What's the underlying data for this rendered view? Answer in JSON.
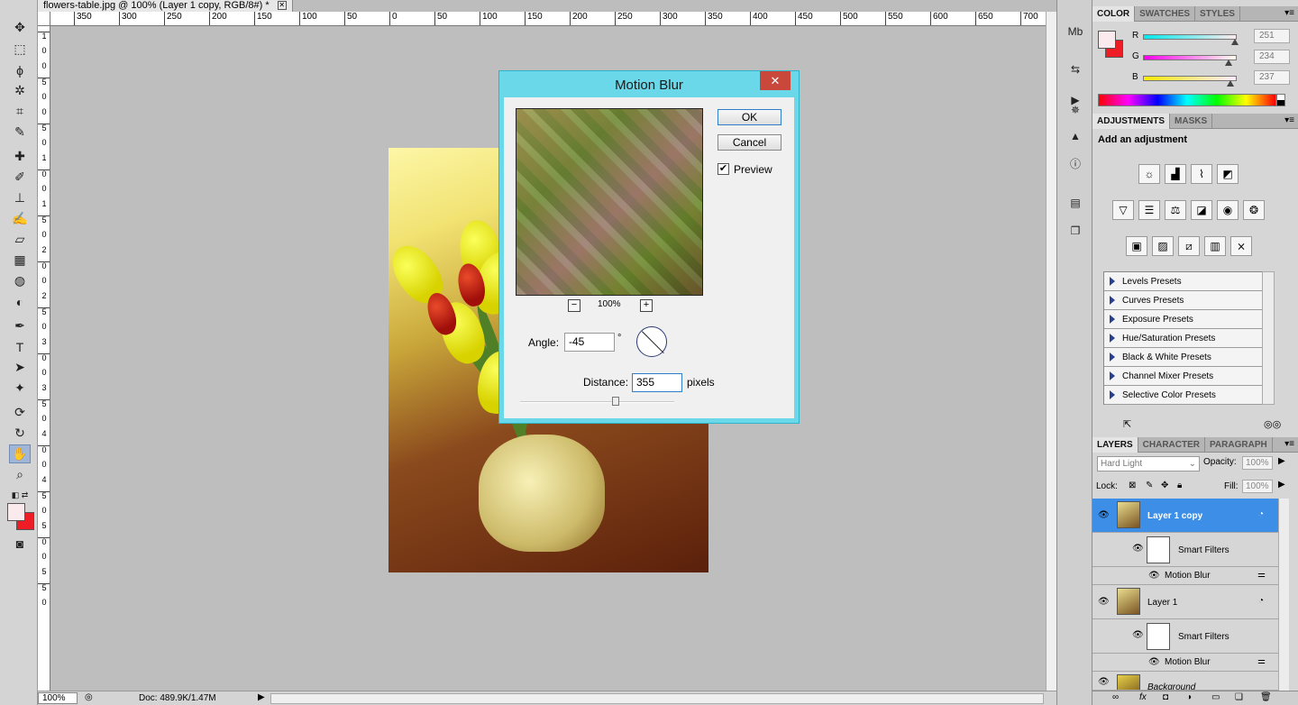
{
  "document": {
    "tab_title": "flowers-table.jpg @ 100% (Layer 1 copy, RGB/8#) *",
    "close_glyph": "✕"
  },
  "rulers": {
    "top_labels": [
      "350",
      "300",
      "250",
      "200",
      "150",
      "100",
      "50",
      "0",
      "50",
      "100",
      "150",
      "200",
      "250",
      "300",
      "350",
      "400",
      "450",
      "500",
      "550",
      "600",
      "650",
      "700"
    ],
    "left_labels": [
      "1",
      "0",
      "0",
      "5",
      "0",
      "0",
      "5",
      "0",
      "1",
      "0",
      "0",
      "1",
      "5",
      "0",
      "2",
      "0",
      "0",
      "2",
      "5",
      "0",
      "3",
      "0",
      "0",
      "3",
      "5",
      "0",
      "4",
      "0",
      "0",
      "4",
      "5",
      "0",
      "5",
      "0",
      "0",
      "5",
      "5",
      "0"
    ]
  },
  "statusbar": {
    "zoom": "100%",
    "doc_info": "Doc: 489.9K/1.47M"
  },
  "color_panel": {
    "tabs": [
      "COLOR",
      "SWATCHES",
      "STYLES"
    ],
    "channels": [
      {
        "label": "R",
        "value": "251",
        "fraction": 0.984
      },
      {
        "label": "G",
        "value": "234",
        "fraction": 0.918
      },
      {
        "label": "B",
        "value": "237",
        "fraction": 0.929
      }
    ],
    "foreground": "#fbeaed",
    "background": "#ee1c24"
  },
  "adjustments_panel": {
    "tabs": [
      "ADJUSTMENTS",
      "MASKS"
    ],
    "title": "Add an adjustment",
    "presets": [
      "Levels Presets",
      "Curves Presets",
      "Exposure Presets",
      "Hue/Saturation Presets",
      "Black & White Presets",
      "Channel Mixer Presets",
      "Selective Color Presets"
    ]
  },
  "layers_panel": {
    "tabs": [
      "LAYERS",
      "CHARACTER",
      "PARAGRAPH"
    ],
    "blend_mode": "Hard Light",
    "opacity_label": "Opacity:",
    "opacity": "100%",
    "lock_label": "Lock:",
    "fill_label": "Fill:",
    "fill": "100%",
    "layers": [
      {
        "name": "Layer 1 copy",
        "selected": true,
        "smart_filters": "Smart Filters",
        "filter": "Motion Blur"
      },
      {
        "name": "Layer 1",
        "selected": false,
        "smart_filters": "Smart Filters",
        "filter": "Motion Blur"
      },
      {
        "name": "Background",
        "selected": false
      }
    ]
  },
  "dialog": {
    "title": "Motion Blur",
    "close_glyph": "✕",
    "ok": "OK",
    "cancel": "Cancel",
    "preview_label": "Preview",
    "preview_checked": "✔",
    "zoom_minus": "−",
    "zoom_plus": "+",
    "zoom_value": "100%",
    "angle_label": "Angle:",
    "angle_value": "-45",
    "degree_symbol": "°",
    "distance_label": "Distance:",
    "distance_value": "355",
    "distance_unit": "pixels",
    "distance_fraction": 0.62
  },
  "colors": {
    "dialog_frame": "#6ad8e8",
    "layer_selected": "#3d8ee6",
    "close_red": "#c9483b"
  }
}
